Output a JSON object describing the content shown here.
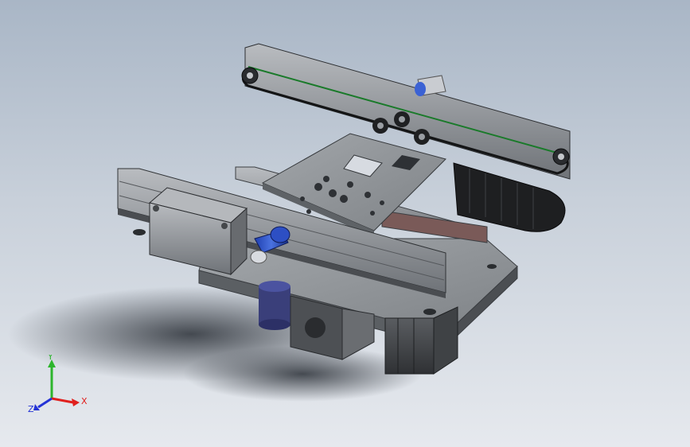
{
  "viewport": {
    "description_hidden": "",
    "colors": {
      "background_top": "#a9b6c6",
      "background_bottom": "#e6e9ee",
      "axis_x": "#e0201e",
      "axis_y": "#2db52d",
      "axis_z": "#2433d6"
    }
  },
  "triad": {
    "x_label": "X",
    "y_label": "Y",
    "z_label": "Z"
  }
}
